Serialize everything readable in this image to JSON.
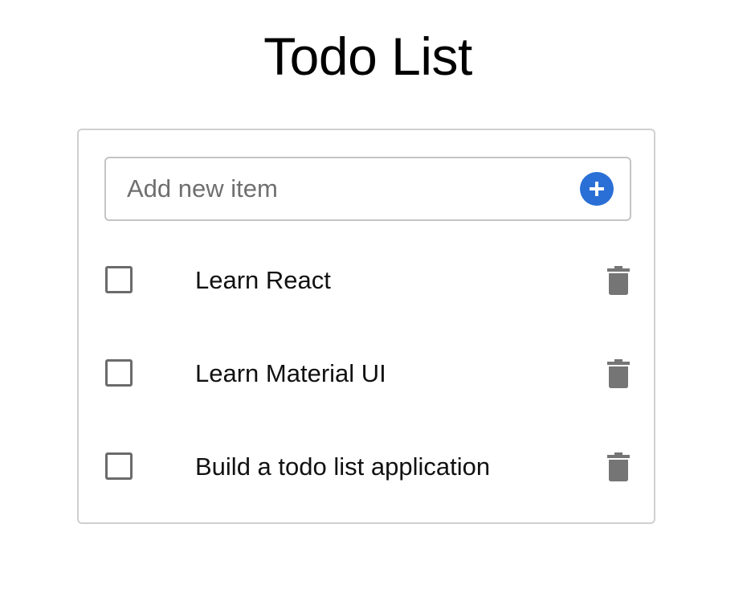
{
  "header": {
    "title": "Todo List"
  },
  "add_item": {
    "placeholder": "Add new item",
    "value": "",
    "button_icon": "plus-circle-icon"
  },
  "todos": [
    {
      "label": "Learn React",
      "completed": false
    },
    {
      "label": "Learn Material UI",
      "completed": false
    },
    {
      "label": "Build a todo list application",
      "completed": false
    }
  ],
  "icons": {
    "delete": "trash-icon",
    "checkbox": "checkbox-unchecked-icon"
  },
  "colors": {
    "accent": "#2a6fd6",
    "icon_gray": "#757575",
    "border": "#c4c4c4"
  }
}
